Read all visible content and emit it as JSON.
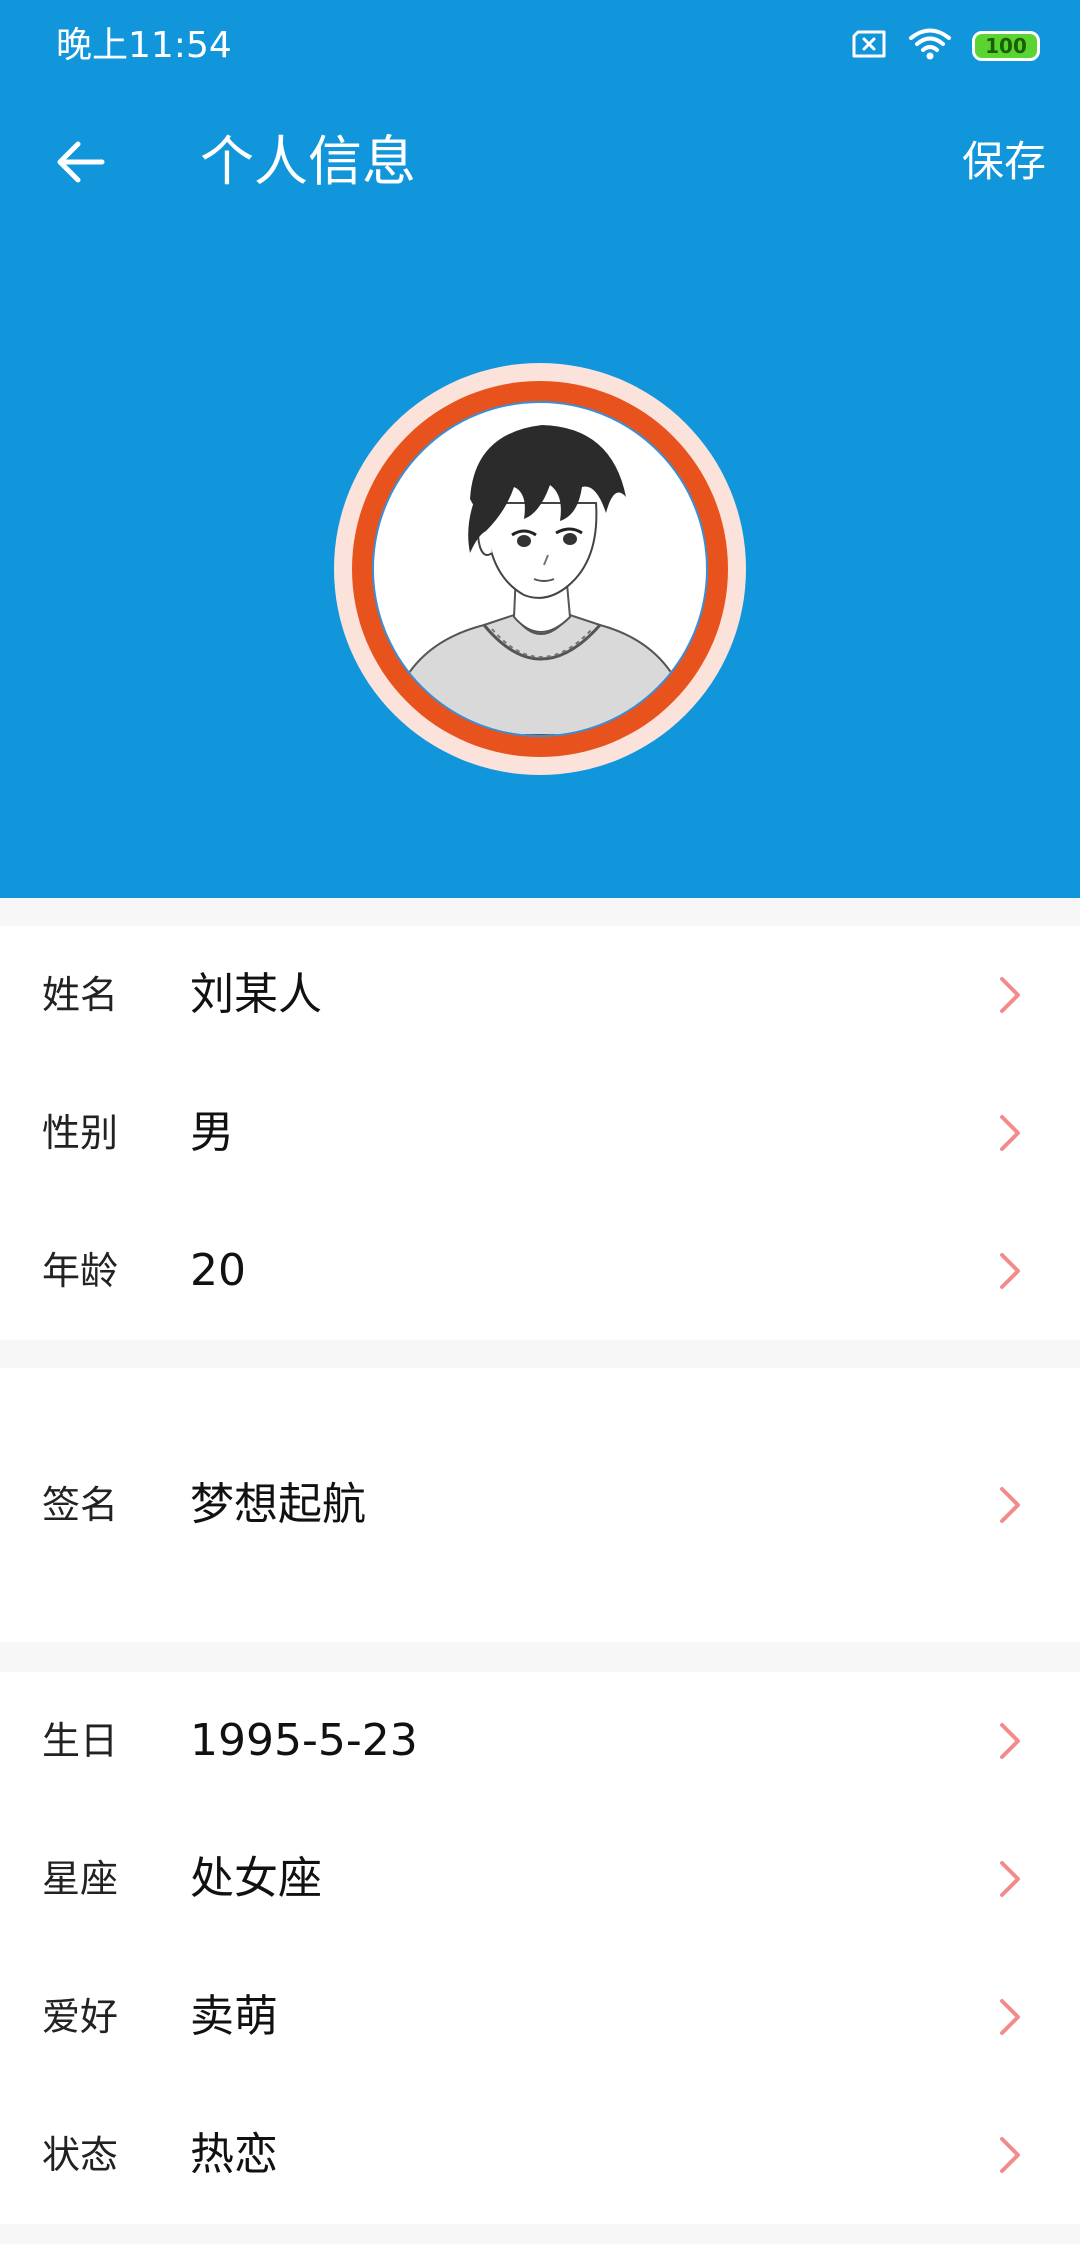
{
  "status_bar": {
    "time": "晚上11:54",
    "battery": "100",
    "icons": [
      "sim-error-icon",
      "wifi-icon",
      "battery-icon"
    ]
  },
  "toolbar": {
    "title": "个人信息",
    "save_label": "保存",
    "back_icon": "arrow-left-icon"
  },
  "profile": {
    "avatar": "anime-boy-avatar"
  },
  "fields": [
    {
      "label": "姓名",
      "value": "刘某人"
    },
    {
      "label": "性别",
      "value": "男"
    },
    {
      "label": "年龄",
      "value": "20"
    },
    {
      "label": "签名",
      "value": "梦想起航"
    },
    {
      "label": "生日",
      "value": "1995-5-23"
    },
    {
      "label": "星座",
      "value": "处女座"
    },
    {
      "label": "爱好",
      "value": "卖萌"
    },
    {
      "label": "状态",
      "value": "热恋"
    }
  ],
  "colors": {
    "header": "#1296db",
    "avatar_ring": "#e8521c",
    "chevron": "#f28c8c",
    "page_background": "#f7f7f7"
  }
}
